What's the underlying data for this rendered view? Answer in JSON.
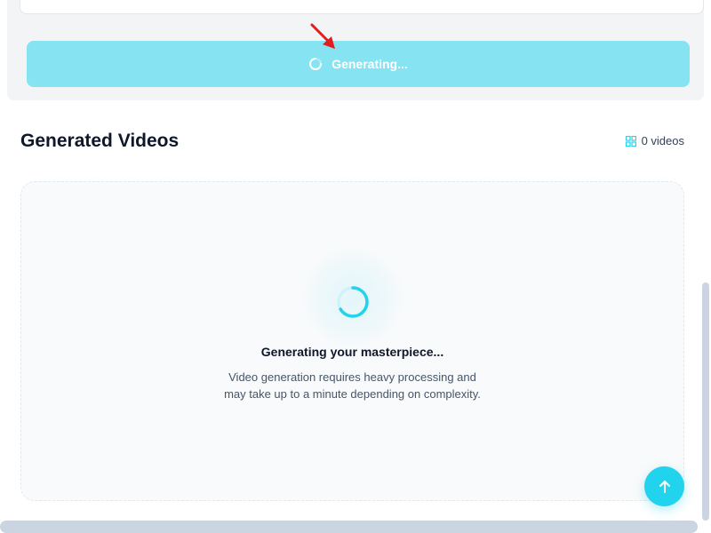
{
  "generate_button": {
    "label": "Generating..."
  },
  "section": {
    "title": "Generated Videos",
    "video_count_label": "0 videos"
  },
  "loading": {
    "title": "Generating your masterpiece...",
    "description_line1": "Video generation requires heavy processing and",
    "description_line2": "may take up to a minute depending on complexity."
  },
  "icons": {
    "button_spinner": "spinner-icon",
    "video_count": "grid-icon",
    "main_spinner": "spinner-icon",
    "scroll_top": "arrow-up-icon",
    "pointer": "red-arrow-icon"
  },
  "colors": {
    "accent": "#22d3ee",
    "button_bg": "#86e3f2",
    "pointer": "#e11d1d"
  }
}
